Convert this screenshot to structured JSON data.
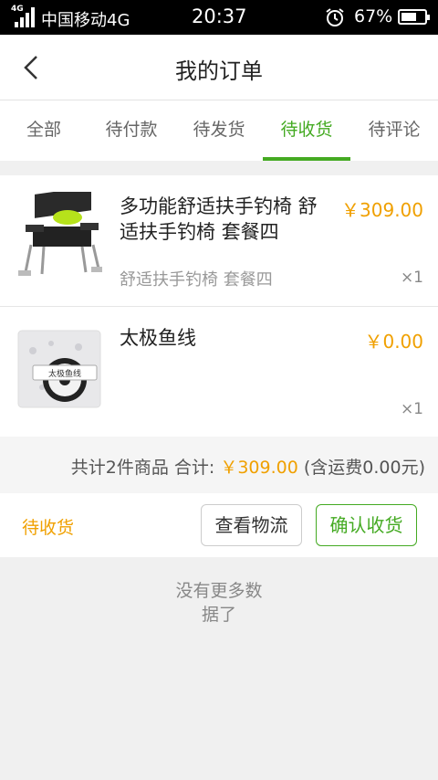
{
  "status_bar": {
    "network_tag": "4G",
    "carrier": "中国移动4G",
    "time": "20:37",
    "battery_percent": "67%",
    "battery_level": 0.67
  },
  "nav": {
    "title": "我的订单"
  },
  "tabs": [
    {
      "label": "全部",
      "active": false
    },
    {
      "label": "待付款",
      "active": false
    },
    {
      "label": "待发货",
      "active": false
    },
    {
      "label": "待收货",
      "active": true
    },
    {
      "label": "待评论",
      "active": false
    }
  ],
  "order": {
    "items": [
      {
        "name": "多功能舒适扶手钓椅 舒适扶手钓椅 套餐四",
        "spec": "舒适扶手钓椅 套餐四",
        "price": "￥309.00",
        "qty": "×1",
        "image_icon": "fishing-chair-image"
      },
      {
        "name": "太极鱼线",
        "spec": "",
        "price": "￥0.00",
        "qty": "×1",
        "image_icon": "fishing-line-image",
        "package_text": "太极鱼线"
      }
    ],
    "summary": {
      "count_text": "共计2件商品 合计:",
      "total": "￥309.00",
      "shipping_note": "(含运费0.00元)"
    },
    "status_label": "待收货",
    "buttons": {
      "logistics": "查看物流",
      "confirm": "确认收货"
    }
  },
  "footer": {
    "no_more": "没有更多数据了"
  },
  "colors": {
    "accent_green": "#44aa22",
    "price_orange": "#f0a000"
  }
}
